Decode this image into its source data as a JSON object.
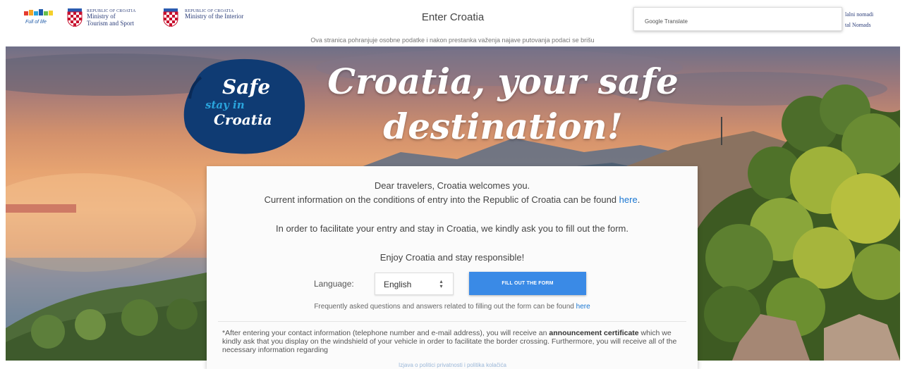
{
  "header": {
    "logo_tourism_alt": "Hrvatska",
    "ministry1_small": "REPUBLIC OF CROATIA",
    "ministry1_line1": "Ministry of",
    "ministry1_line2": "Tourism and Sport",
    "ministry2_small": "REPUBLIC OF CROATIA",
    "ministry2_line1": "Ministry of the Interior",
    "site_title": "Enter Croatia",
    "google_translate": "Google Translate",
    "nomad_line1": "lalni nomadi",
    "nomad_line2": "tal Nomads"
  },
  "notice": "Ova stranica pohranjuje osobne podatke i nakon prestanka važenja najave putovanja podaci se brišu",
  "hero": {
    "badge_line1": "Safe",
    "badge_line2": "stay in",
    "badge_line3": "Croatia",
    "headline_line1": "Croatia, your safe",
    "headline_line2": "destination!"
  },
  "card": {
    "greeting": "Dear travelers, Croatia welcomes you.",
    "info_text": "Current information on the conditions of entry into the Republic of Croatia can be found",
    "info_link": "here",
    "info_end": ".",
    "request": "In order to facilitate your entry and stay in Croatia, we kindly ask you to fill out the form.",
    "enjoy": "Enjoy Croatia and stay responsible!",
    "language_label": "Language:",
    "language_value": "English",
    "fill_button": "FILL OUT THE FORM",
    "faq_text": "Frequently asked questions and answers related to filling out the form can be found",
    "faq_link": "here",
    "footnote_start": "*After entering your contact information (telephone number and e-mail address), you will receive an",
    "footnote_bold": "announcement certificate",
    "footnote_rest": "which we kindly ask that you display on the windshield of your vehicle in order to facilitate the border crossing. Furthermore, you will receive all of the necessary information regarding"
  },
  "bottom_link": "Izjava o politici privatnosti i politika kolačića",
  "colors": {
    "primary_button": "#3a8ae6",
    "link": "#1976d2",
    "badge_blue": "#0f3b73",
    "ministry_text": "#2b3d79"
  },
  "icons": {
    "select_arrow": "chevron-updown-icon",
    "crest": "croatian-coat-of-arms-icon"
  }
}
